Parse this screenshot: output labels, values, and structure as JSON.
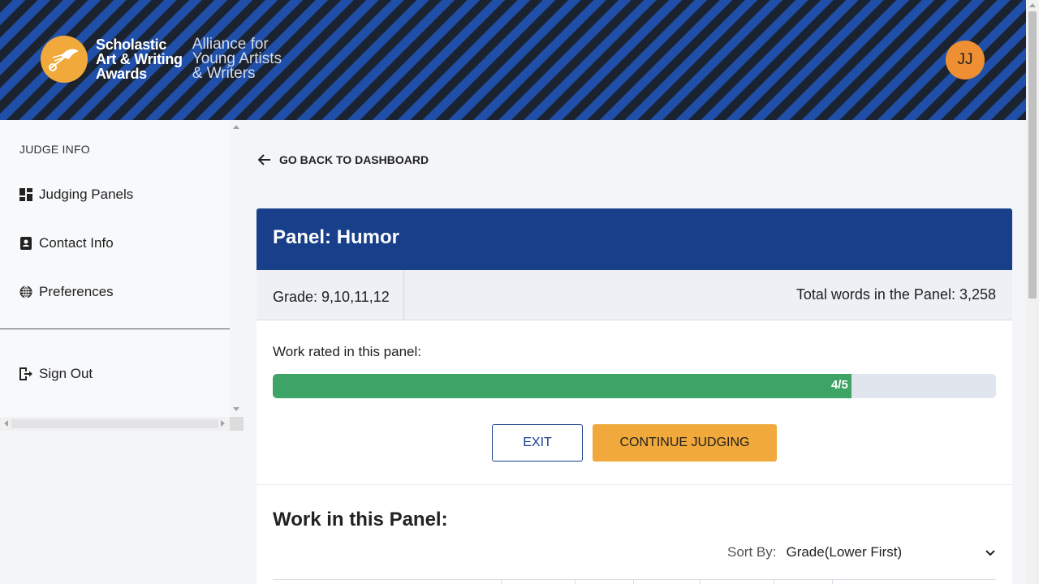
{
  "header": {
    "logo_title_lines": [
      "Scholastic",
      "Art & Writing",
      "Awards"
    ],
    "logo_sub_lines": [
      "Alliance for",
      "Young Artists",
      "& Writers"
    ],
    "avatar_initials": "JJ",
    "colors": {
      "stripe_dark": "#1b2330",
      "stripe_blue": "#1f4fa8",
      "logo": "#f2a93b",
      "avatar": "#ee8f33"
    }
  },
  "sidebar": {
    "heading": "JUDGE INFO",
    "items": [
      {
        "label": "Judging Panels",
        "icon": "dashboard-icon"
      },
      {
        "label": "Contact Info",
        "icon": "contact-card-icon"
      },
      {
        "label": "Preferences",
        "icon": "globe-icon"
      }
    ],
    "sign_out": {
      "label": "Sign Out",
      "icon": "sign-out-icon"
    }
  },
  "main": {
    "back_label": "GO BACK TO DASHBOARD",
    "panel": {
      "title": "Panel: Humor",
      "grade": "Grade: 9,10,11,12",
      "total_words": "Total words in the Panel: 3,258",
      "rated_label": "Work rated in this panel:",
      "progress": {
        "text": "4/5",
        "fraction": 0.8,
        "color": "#3da466"
      },
      "exit_label": "EXIT",
      "continue_label": "CONTINUE JUDGING",
      "work_title": "Work in this Panel:",
      "sort_label": "Sort By:",
      "sort_value": "Grade(Lower First)"
    }
  }
}
